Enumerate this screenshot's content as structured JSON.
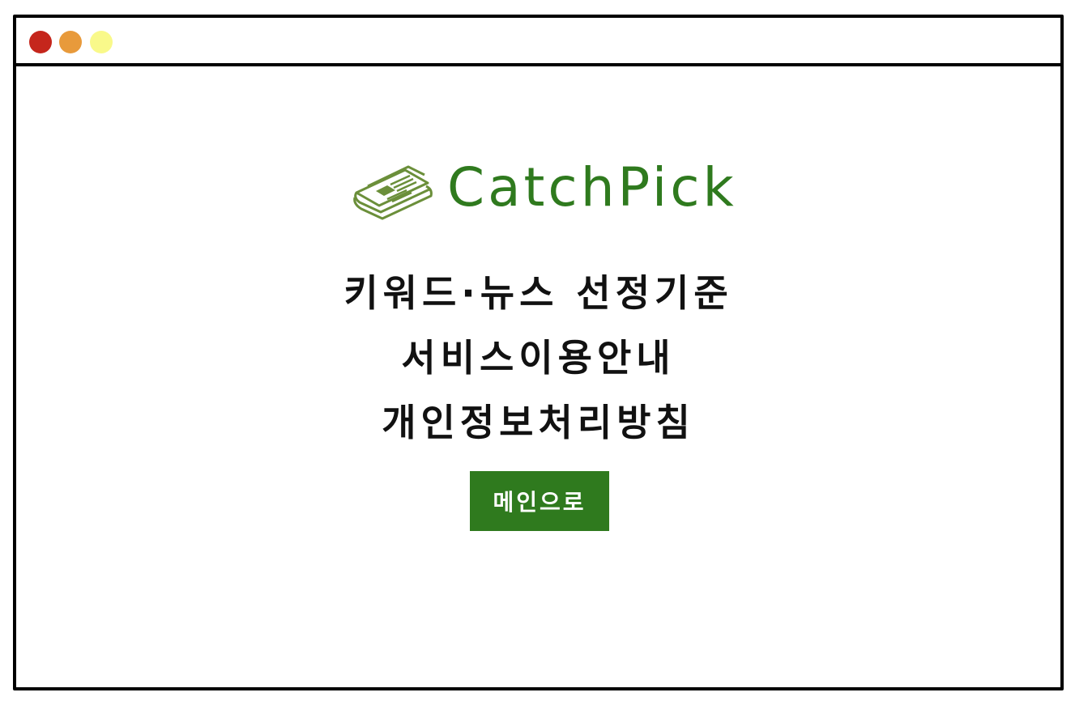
{
  "colors": {
    "brand_green": "#2f7a1e",
    "icon_green": "#6b8f3a",
    "dot_red": "#c5261c",
    "dot_orange": "#e89a3b",
    "dot_yellow": "#f9f98a"
  },
  "window": {
    "controls": [
      "close-dot",
      "minimize-dot",
      "maximize-dot"
    ]
  },
  "brand": {
    "icon": "newspaper-icon",
    "name": "CatchPick"
  },
  "menu": {
    "items": [
      {
        "label": "키워드·뉴스 선정기준"
      },
      {
        "label": "서비스이용안내"
      },
      {
        "label": "개인정보처리방침"
      }
    ]
  },
  "main_button": {
    "label": "메인으로"
  }
}
